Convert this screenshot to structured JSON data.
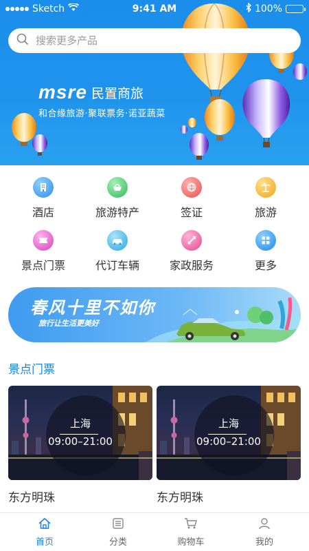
{
  "status_bar": {
    "carrier": "Sketch",
    "time": "9:41 AM",
    "battery": "100%"
  },
  "search": {
    "placeholder": "搜索更多产品"
  },
  "brand": {
    "logo": "msre",
    "name": "民置商旅",
    "tagline": "和合缘旅游·聚联票务·诺亚蔬菜"
  },
  "categories": [
    {
      "label": "酒店",
      "icon": "hotel-building-icon",
      "color": "#4aa8f5"
    },
    {
      "label": "旅游特产",
      "icon": "specialty-basket-icon",
      "color": "#4fcf73"
    },
    {
      "label": "签证",
      "icon": "visa-globe-icon",
      "color": "#f26a6a"
    },
    {
      "label": "旅游",
      "icon": "beach-palm-icon",
      "color": "#f7b524"
    },
    {
      "label": "景点门票",
      "icon": "ticket-icon",
      "color": "#e756c7"
    },
    {
      "label": "代订车辆",
      "icon": "car-icon",
      "color": "#3fb8e6"
    },
    {
      "label": "家政服务",
      "icon": "home-service-icon",
      "color": "#f25aa0"
    },
    {
      "label": "更多",
      "icon": "more-grid-icon",
      "color": "#2f9cf0"
    }
  ],
  "banner": {
    "title": "春风十里不如你",
    "subtitle": "旅行让生活更美好"
  },
  "section": {
    "title": "景点门票"
  },
  "cards": [
    {
      "city": "上海",
      "hours": "09:00–21:00",
      "name": "东方明珠"
    },
    {
      "city": "上海",
      "hours": "09:00–21:00",
      "name": "东方明珠"
    }
  ],
  "tabs": [
    {
      "label": "首页",
      "icon": "home-icon",
      "active": true
    },
    {
      "label": "分类",
      "icon": "category-icon",
      "active": false
    },
    {
      "label": "购物车",
      "icon": "cart-icon",
      "active": false
    },
    {
      "label": "我的",
      "icon": "user-icon",
      "active": false
    }
  ],
  "colors": {
    "primary": "#1e82e6",
    "hero_blue": "#1f93ec"
  }
}
